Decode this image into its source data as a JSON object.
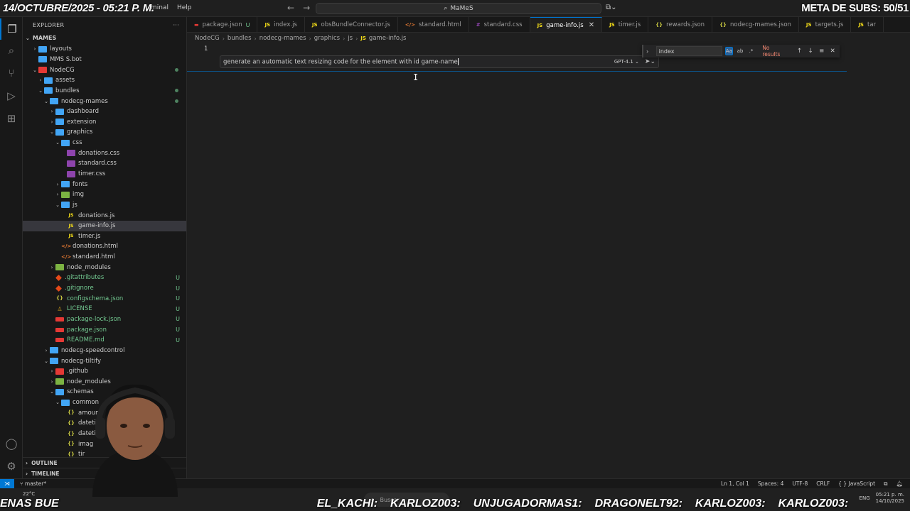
{
  "overlay": {
    "date_time": "14/OCTUBRE/2025 - 05:21 P. M.",
    "subs_goal": "META DE SUBS: 50/51"
  },
  "titlebar": {
    "menu": [
      "minal",
      "Help"
    ],
    "search": "MaMeS"
  },
  "sidebar": {
    "title": "EXPLORER",
    "root": "MAMES",
    "tree": [
      {
        "label": "layouts",
        "indent": 1,
        "type": "folder",
        "chev": "›"
      },
      {
        "label": "MMS S.bot",
        "indent": 1,
        "type": "bot",
        "chev": ""
      },
      {
        "label": "NodeCG",
        "indent": 1,
        "type": "folder-r",
        "chev": "⌄",
        "dot": true
      },
      {
        "label": "assets",
        "indent": 2,
        "type": "folder",
        "chev": "›"
      },
      {
        "label": "bundles",
        "indent": 2,
        "type": "folder",
        "chev": "⌄",
        "dot": true
      },
      {
        "label": "nodecg-mames",
        "indent": 3,
        "type": "folder",
        "chev": "⌄",
        "dot": true
      },
      {
        "label": "dashboard",
        "indent": 4,
        "type": "folder",
        "chev": "›"
      },
      {
        "label": "extension",
        "indent": 4,
        "type": "folder",
        "chev": "›"
      },
      {
        "label": "graphics",
        "indent": 4,
        "type": "folder",
        "chev": "⌄"
      },
      {
        "label": "css",
        "indent": 5,
        "type": "folder",
        "chev": "⌄"
      },
      {
        "label": "donations.css",
        "indent": 6,
        "type": "css",
        "chev": ""
      },
      {
        "label": "standard.css",
        "indent": 6,
        "type": "css",
        "chev": ""
      },
      {
        "label": "timer.css",
        "indent": 6,
        "type": "css",
        "chev": ""
      },
      {
        "label": "fonts",
        "indent": 5,
        "type": "folder",
        "chev": "›"
      },
      {
        "label": "img",
        "indent": 5,
        "type": "folder-g",
        "chev": "›"
      },
      {
        "label": "js",
        "indent": 5,
        "type": "folder",
        "chev": "⌄"
      },
      {
        "label": "donations.js",
        "indent": 6,
        "type": "js",
        "chev": ""
      },
      {
        "label": "game-info.js",
        "indent": 6,
        "type": "js",
        "chev": "",
        "selected": true
      },
      {
        "label": "timer.js",
        "indent": 6,
        "type": "js",
        "chev": ""
      },
      {
        "label": "donations.html",
        "indent": 5,
        "type": "html",
        "chev": ""
      },
      {
        "label": "standard.html",
        "indent": 5,
        "type": "html",
        "chev": ""
      },
      {
        "label": "node_modules",
        "indent": 4,
        "type": "folder-g",
        "chev": "›"
      },
      {
        "label": ".gitattributes",
        "indent": 4,
        "type": "git",
        "chev": "",
        "status": "U"
      },
      {
        "label": ".gitignore",
        "indent": 4,
        "type": "git",
        "chev": "",
        "status": "U"
      },
      {
        "label": "configschema.json",
        "indent": 4,
        "type": "json",
        "chev": "",
        "status": "U"
      },
      {
        "label": "LICENSE",
        "indent": 4,
        "type": "lic",
        "chev": "",
        "status": "U"
      },
      {
        "label": "package-lock.json",
        "indent": 4,
        "type": "npm",
        "chev": "",
        "status": "U"
      },
      {
        "label": "package.json",
        "indent": 4,
        "type": "npm",
        "chev": "",
        "status": "U"
      },
      {
        "label": "README.md",
        "indent": 4,
        "type": "md",
        "chev": "",
        "status": "U"
      },
      {
        "label": "nodecg-speedcontrol",
        "indent": 3,
        "type": "folder",
        "chev": "›"
      },
      {
        "label": "nodecg-tiltify",
        "indent": 3,
        "type": "folder",
        "chev": "⌄"
      },
      {
        "label": ".github",
        "indent": 4,
        "type": "folder-r",
        "chev": "›"
      },
      {
        "label": "node_modules",
        "indent": 4,
        "type": "folder-g",
        "chev": "›"
      },
      {
        "label": "schemas",
        "indent": 4,
        "type": "folder",
        "chev": "⌄"
      },
      {
        "label": "common",
        "indent": 5,
        "type": "folder",
        "chev": "⌄"
      },
      {
        "label": "amoun",
        "indent": 6,
        "type": "json",
        "chev": ""
      },
      {
        "label": "datetir",
        "indent": 6,
        "type": "json",
        "chev": ""
      },
      {
        "label": "datetir",
        "indent": 6,
        "type": "json",
        "chev": ""
      },
      {
        "label": "imag",
        "indent": 6,
        "type": "json",
        "chev": ""
      },
      {
        "label": "tir",
        "indent": 6,
        "type": "json",
        "chev": ""
      }
    ],
    "outline": "OUTLINE",
    "timeline": "TIMELINE"
  },
  "tabs": [
    {
      "label": "package.json",
      "icon": "npm",
      "mod": "U"
    },
    {
      "label": "index.js",
      "icon": "js"
    },
    {
      "label": "obsBundleConnector.js",
      "icon": "js"
    },
    {
      "label": "standard.html",
      "icon": "html"
    },
    {
      "label": "standard.css",
      "icon": "css"
    },
    {
      "label": "game-info.js",
      "icon": "js",
      "active": true
    },
    {
      "label": "timer.js",
      "icon": "js"
    },
    {
      "label": "rewards.json",
      "icon": "json"
    },
    {
      "label": "nodecg-mames.json",
      "icon": "json"
    },
    {
      "label": "targets.js",
      "icon": "js"
    },
    {
      "label": "tar",
      "icon": "js"
    }
  ],
  "breadcrumb": [
    "NodeCG",
    "bundles",
    "nodecg-mames",
    "graphics",
    "js",
    "game-info.js"
  ],
  "editor": {
    "line_number": "1",
    "inline_chat_text": "generate an automatic text resizing code for the element with id game-name",
    "model": "GPT-4.1"
  },
  "find": {
    "query": "index",
    "case_label": "Aa",
    "word_label": "ab",
    "regex_label": ".*",
    "no_results": "No results"
  },
  "statusbar": {
    "branch": "master*",
    "position": "Ln 1, Col 1",
    "spaces": "Spaces: 4",
    "encoding": "UTF-8",
    "eol": "CRLF",
    "language": "JavaScript"
  },
  "taskbar": {
    "weather": "22°C",
    "search_placeholder": "Buscar",
    "lang": "ENG",
    "clock": "05:21 p. m.",
    "date": "14/10/2025"
  },
  "ticker": [
    "ENAS BUE",
    "EL_KACHI:",
    "KARLOZ003:",
    "UNJUGADORMAS1:",
    "DRAGONELT92:",
    "KARLOZ003:",
    "KARLOZ003:"
  ]
}
